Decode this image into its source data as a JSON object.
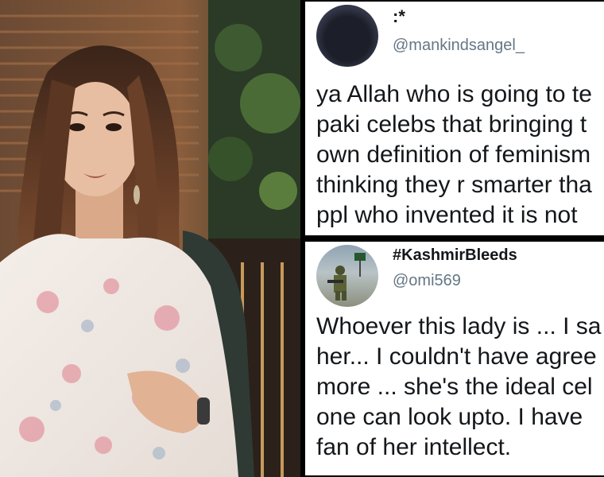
{
  "tweets": [
    {
      "display_name": ":*",
      "handle": "@mankindsangel_",
      "lines": [
        "ya Allah who is going to te",
        "paki celebs that bringing t",
        "own definition of feminism",
        "thinking they r smarter tha",
        "ppl who invented it is not"
      ]
    },
    {
      "display_name": "#KashmirBleeds",
      "handle": "@omi569",
      "lines": [
        "Whoever this lady is ... I sa",
        "her... I couldn't have agree",
        "more ... she's the ideal cel",
        "one can look upto. I have",
        "fan of her intellect."
      ]
    }
  ],
  "colors": {
    "text": "#14171a",
    "handle": "#657786",
    "background": "#ffffff"
  }
}
